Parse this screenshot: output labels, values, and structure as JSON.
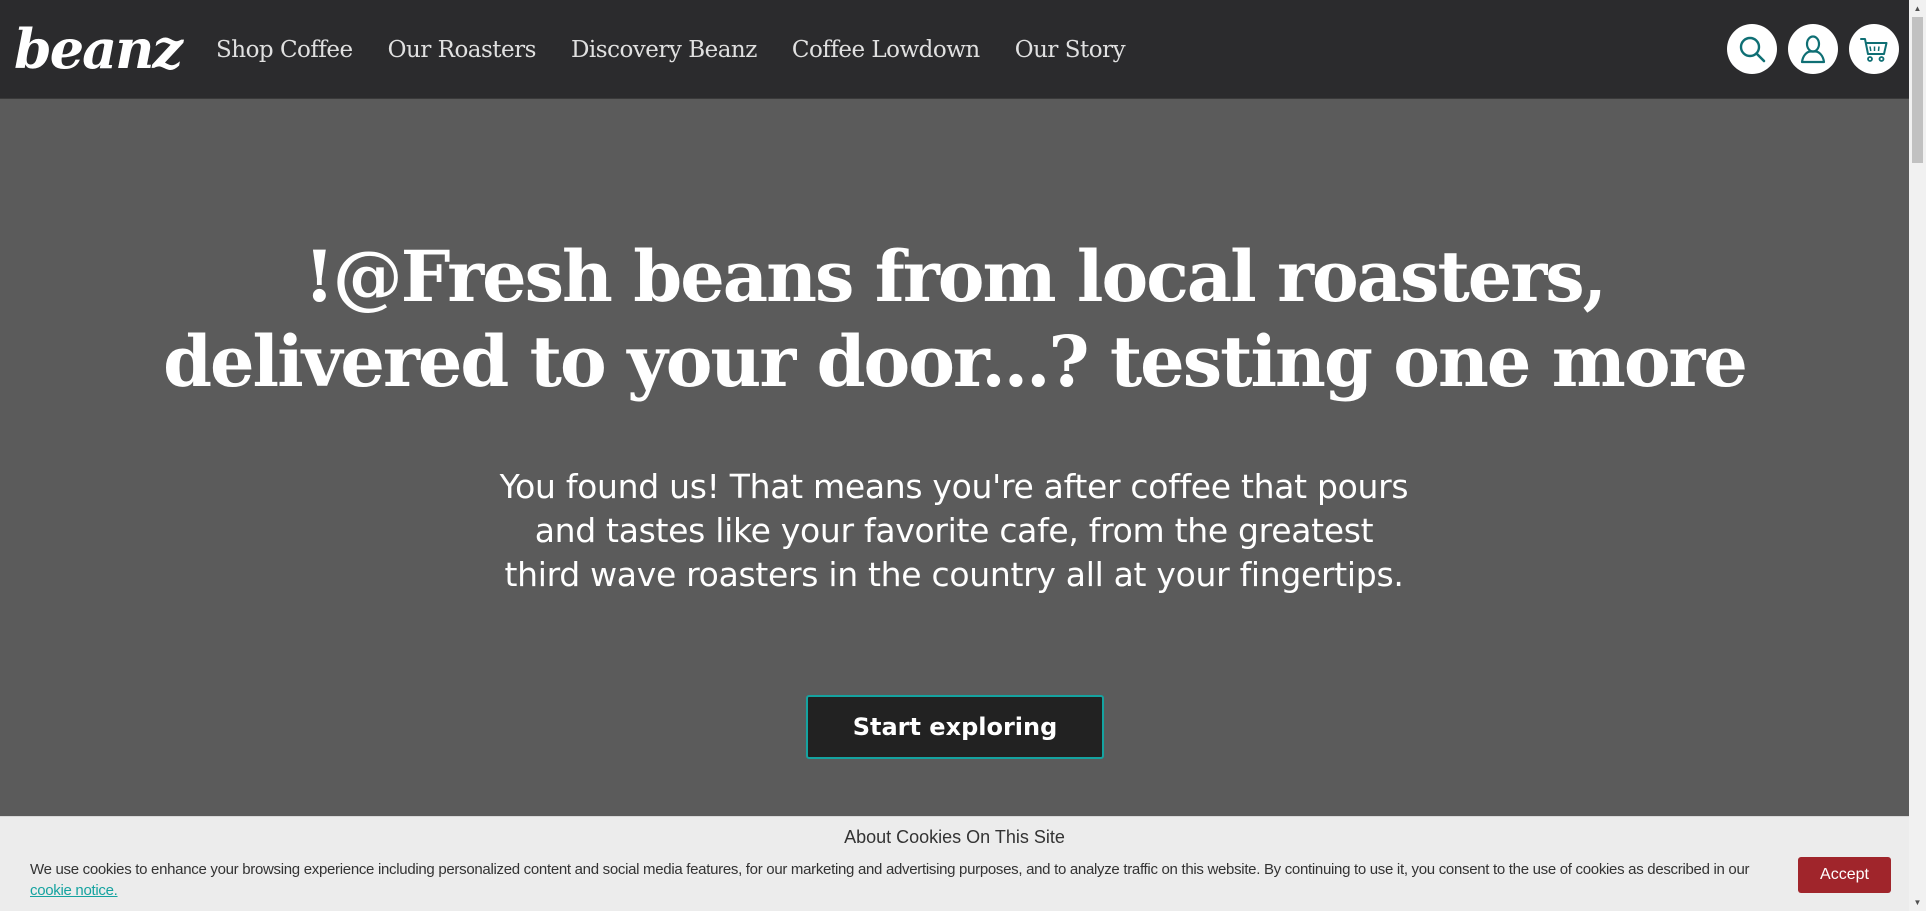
{
  "header": {
    "logo_text": "beanz",
    "nav": [
      {
        "label": "Shop Coffee"
      },
      {
        "label": "Our Roasters"
      },
      {
        "label": "Discovery Beanz"
      },
      {
        "label": "Coffee Lowdown"
      },
      {
        "label": "Our Story"
      }
    ],
    "icons": {
      "search": "search-icon",
      "account": "user-icon",
      "cart": "cart-icon"
    }
  },
  "hero": {
    "title_line1": "!@Fresh beans from local roasters,",
    "title_line2": "delivered to your door...? testing one more",
    "subtitle_line1": "You found us! That means you're after coffee that pours",
    "subtitle_line2": "and tastes like your favorite cafe, from the greatest",
    "subtitle_line3": "third wave roasters in the country all at your fingertips.",
    "cta_label": "Start exploring"
  },
  "cookie_banner": {
    "title": "About Cookies On This Site",
    "body": "We use cookies to enhance your browsing experience including personalized content and social media features, for our marketing and advertising purposes, and to analyze traffic on this website. By continuing to use it, you consent to the use of cookies as described in our ",
    "link_text": "cookie notice.",
    "accept_label": "Accept"
  },
  "colors": {
    "header_bg": "#2b2b2d",
    "hero_bg": "#5b5b5b",
    "accent_teal": "#15a3a0",
    "accept_red": "#a0252b"
  }
}
